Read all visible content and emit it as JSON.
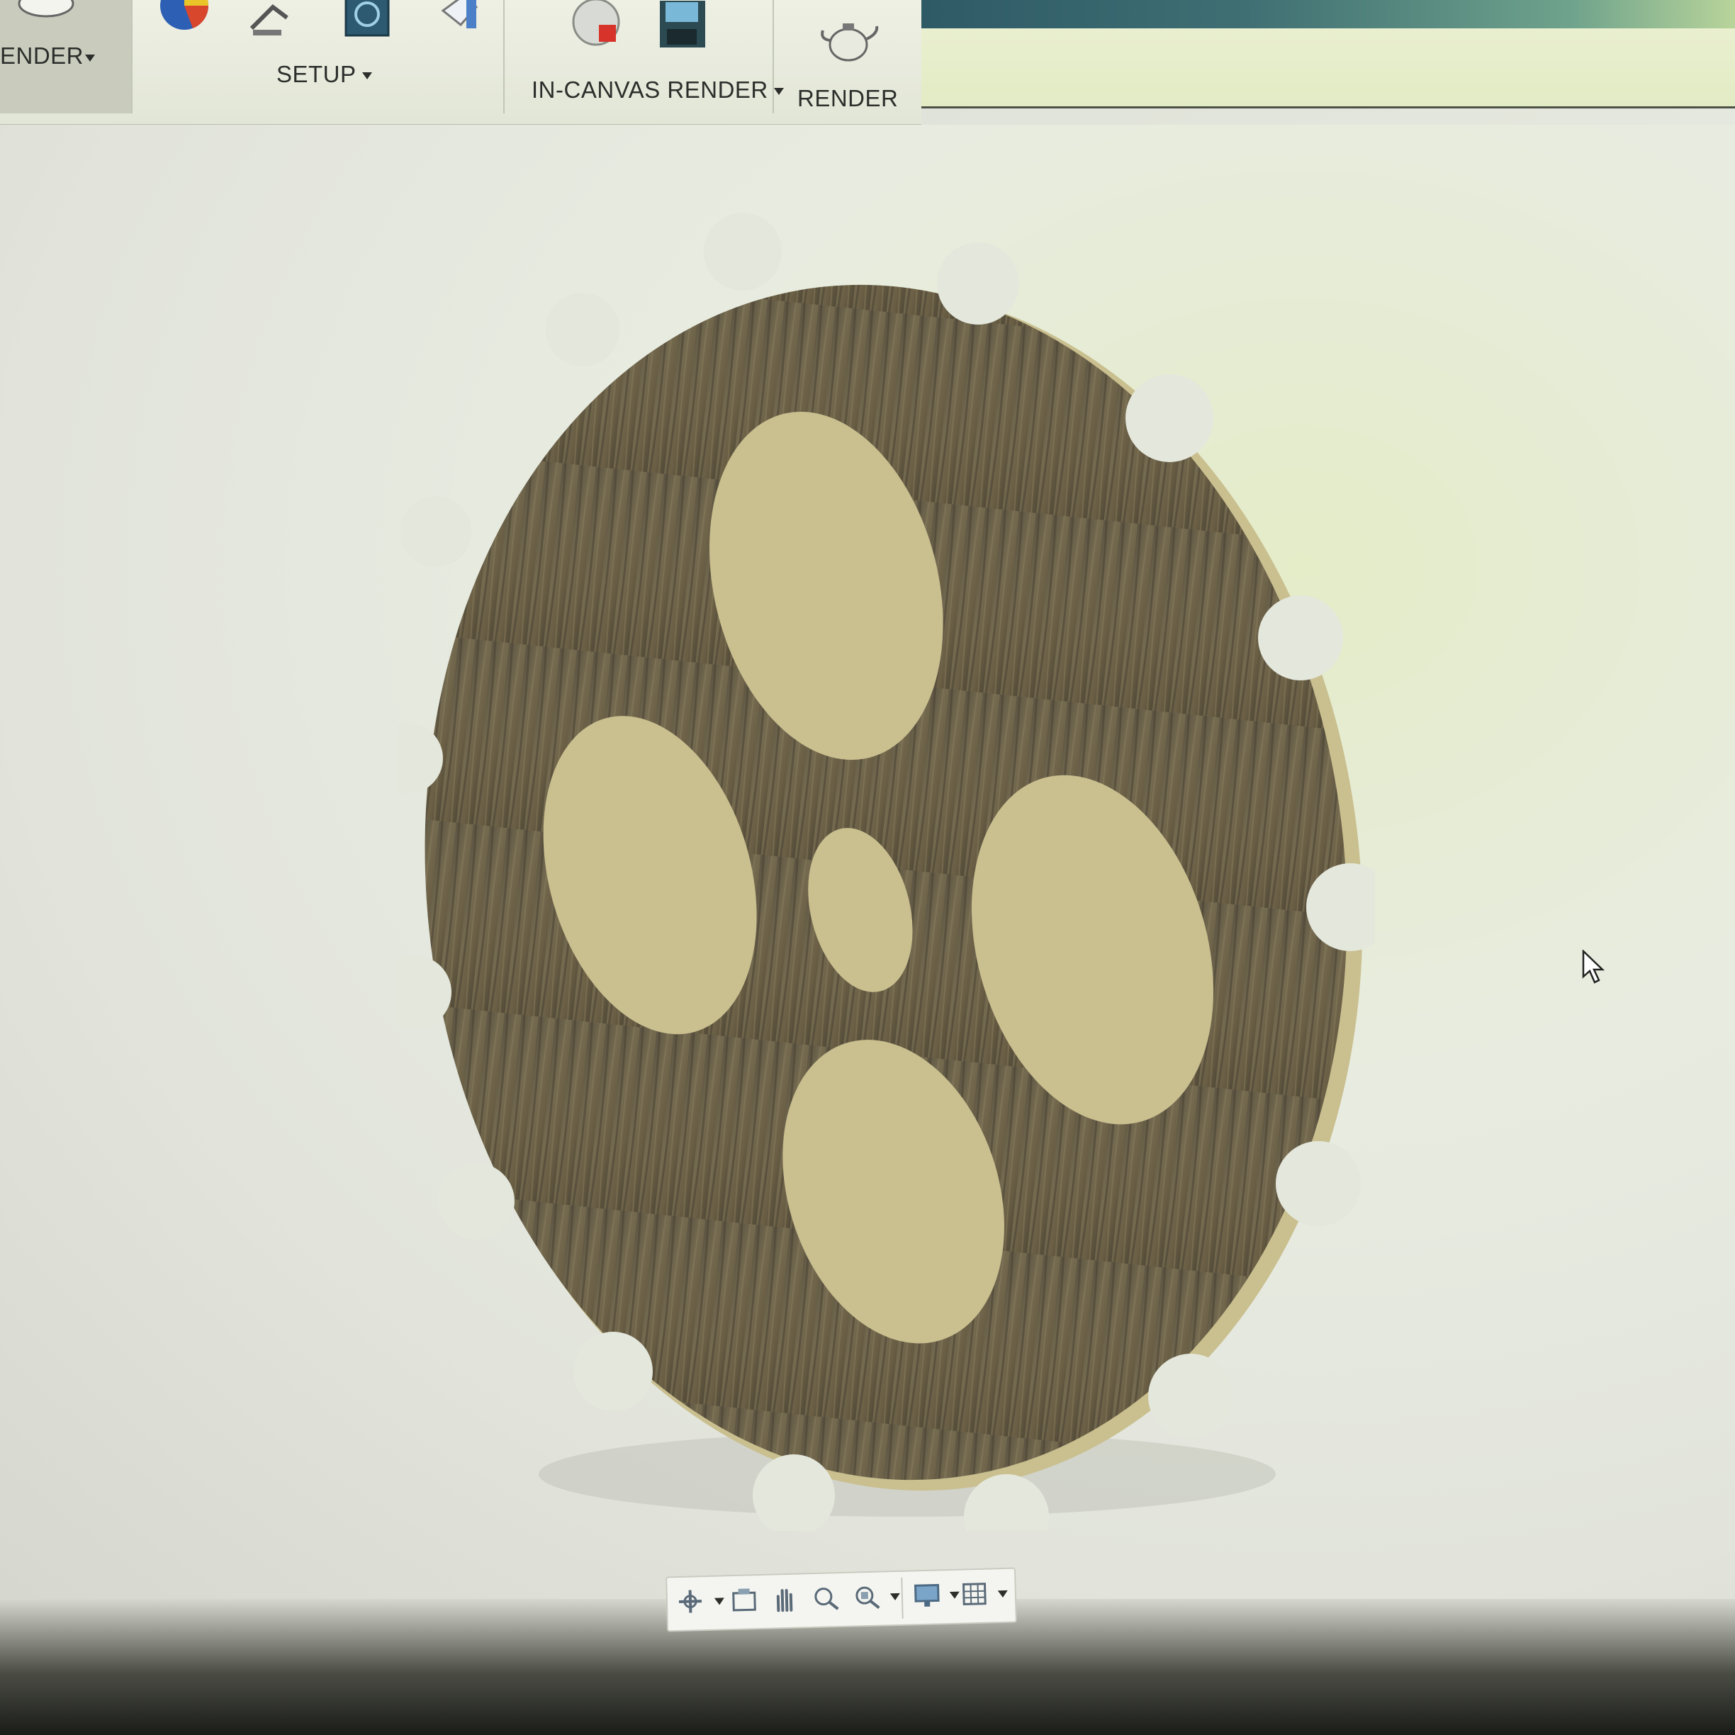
{
  "toolbar": {
    "groups": [
      {
        "id": "render-mode",
        "label": "ENDER"
      },
      {
        "id": "setup",
        "label": "SETUP"
      },
      {
        "id": "in-canvas-render",
        "label": "IN-CANVAS RENDER"
      },
      {
        "id": "render",
        "label": "RENDER"
      }
    ],
    "icons": [
      "scene-settings-icon",
      "appearance-icon",
      "environment-lamp-icon",
      "texture-map-icon",
      "decal-icon",
      "in-canvas-render-sphere-icon",
      "capture-image-icon",
      "render-teapot-icon"
    ]
  },
  "viewport": {
    "model": "wooden-gear-plate",
    "material_color": "#6e6248",
    "teeth_count": 16,
    "holes_count": 5
  },
  "navbar": {
    "icons": [
      "orbit-icon",
      "look-at-icon",
      "pan-icon",
      "zoom-icon",
      "fit-icon",
      "display-settings-icon",
      "grid-settings-icon"
    ]
  },
  "colors": {
    "toolbar_bg": "#e8ebdc",
    "canvas_bg": "#e6e9de",
    "accent_blue": "#2e5a66"
  }
}
